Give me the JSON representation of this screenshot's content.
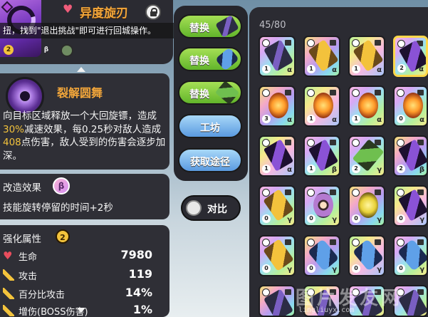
{
  "weapon": {
    "title": "异度旋刃",
    "level": "2",
    "tier": "β"
  },
  "hint": "扭，找到\"退出挑战\"即可进行回城操作。",
  "skill": {
    "name": "裂解圆舞",
    "desc_1": "向目标区域释放一个大回旋镖，造成",
    "desc_2": "30%",
    "desc_3": "减速效果，每0.25秒对敌人造成",
    "desc_4": "408",
    "desc_5": "点伤害，敌人受到的伤害会逐步加深。"
  },
  "modification": {
    "title": "改造效果",
    "badge": "β",
    "desc": "技能旋转停留的时间+2秒"
  },
  "stats": {
    "title": "强化属性",
    "level": "2",
    "rows": [
      {
        "label": "生命",
        "value": "7980"
      },
      {
        "label": "攻击",
        "value": "119"
      },
      {
        "label": "百分比攻击",
        "value": "14%"
      },
      {
        "label": "增伤(BOSS伤害)",
        "value": "1%"
      }
    ]
  },
  "actions": {
    "replace_1": "替换",
    "replace_2": "替换",
    "replace_3": "替换",
    "workshop": "工坊",
    "obtain": "获取途径"
  },
  "compare": "对比",
  "inventory": {
    "count": "45/80",
    "slots": [
      {
        "level": "1",
        "tier": "α"
      },
      {
        "level": "1",
        "tier": "α"
      },
      {
        "level": "1",
        "tier": "α"
      },
      {
        "level": "2",
        "tier": "α"
      },
      {
        "level": "3",
        "tier": "α"
      },
      {
        "level": "1",
        "tier": "α"
      },
      {
        "level": "1",
        "tier": "α"
      },
      {
        "level": "0",
        "tier": "α"
      },
      {
        "level": "1",
        "tier": "α"
      },
      {
        "level": "1",
        "tier": "β"
      },
      {
        "level": "2",
        "tier": "γ"
      },
      {
        "level": "2",
        "tier": "β"
      },
      {
        "level": "0",
        "tier": "γ"
      },
      {
        "level": "0",
        "tier": "γ"
      },
      {
        "level": "0",
        "tier": "γ"
      },
      {
        "level": "0",
        "tier": "γ"
      },
      {
        "level": "0",
        "tier": "γ"
      },
      {
        "level": "0",
        "tier": "γ"
      },
      {
        "level": "0",
        "tier": "γ"
      },
      {
        "level": "0",
        "tier": "γ"
      }
    ]
  },
  "watermark": {
    "big": "图片发友网",
    "small": "lingliuyx.com"
  }
}
